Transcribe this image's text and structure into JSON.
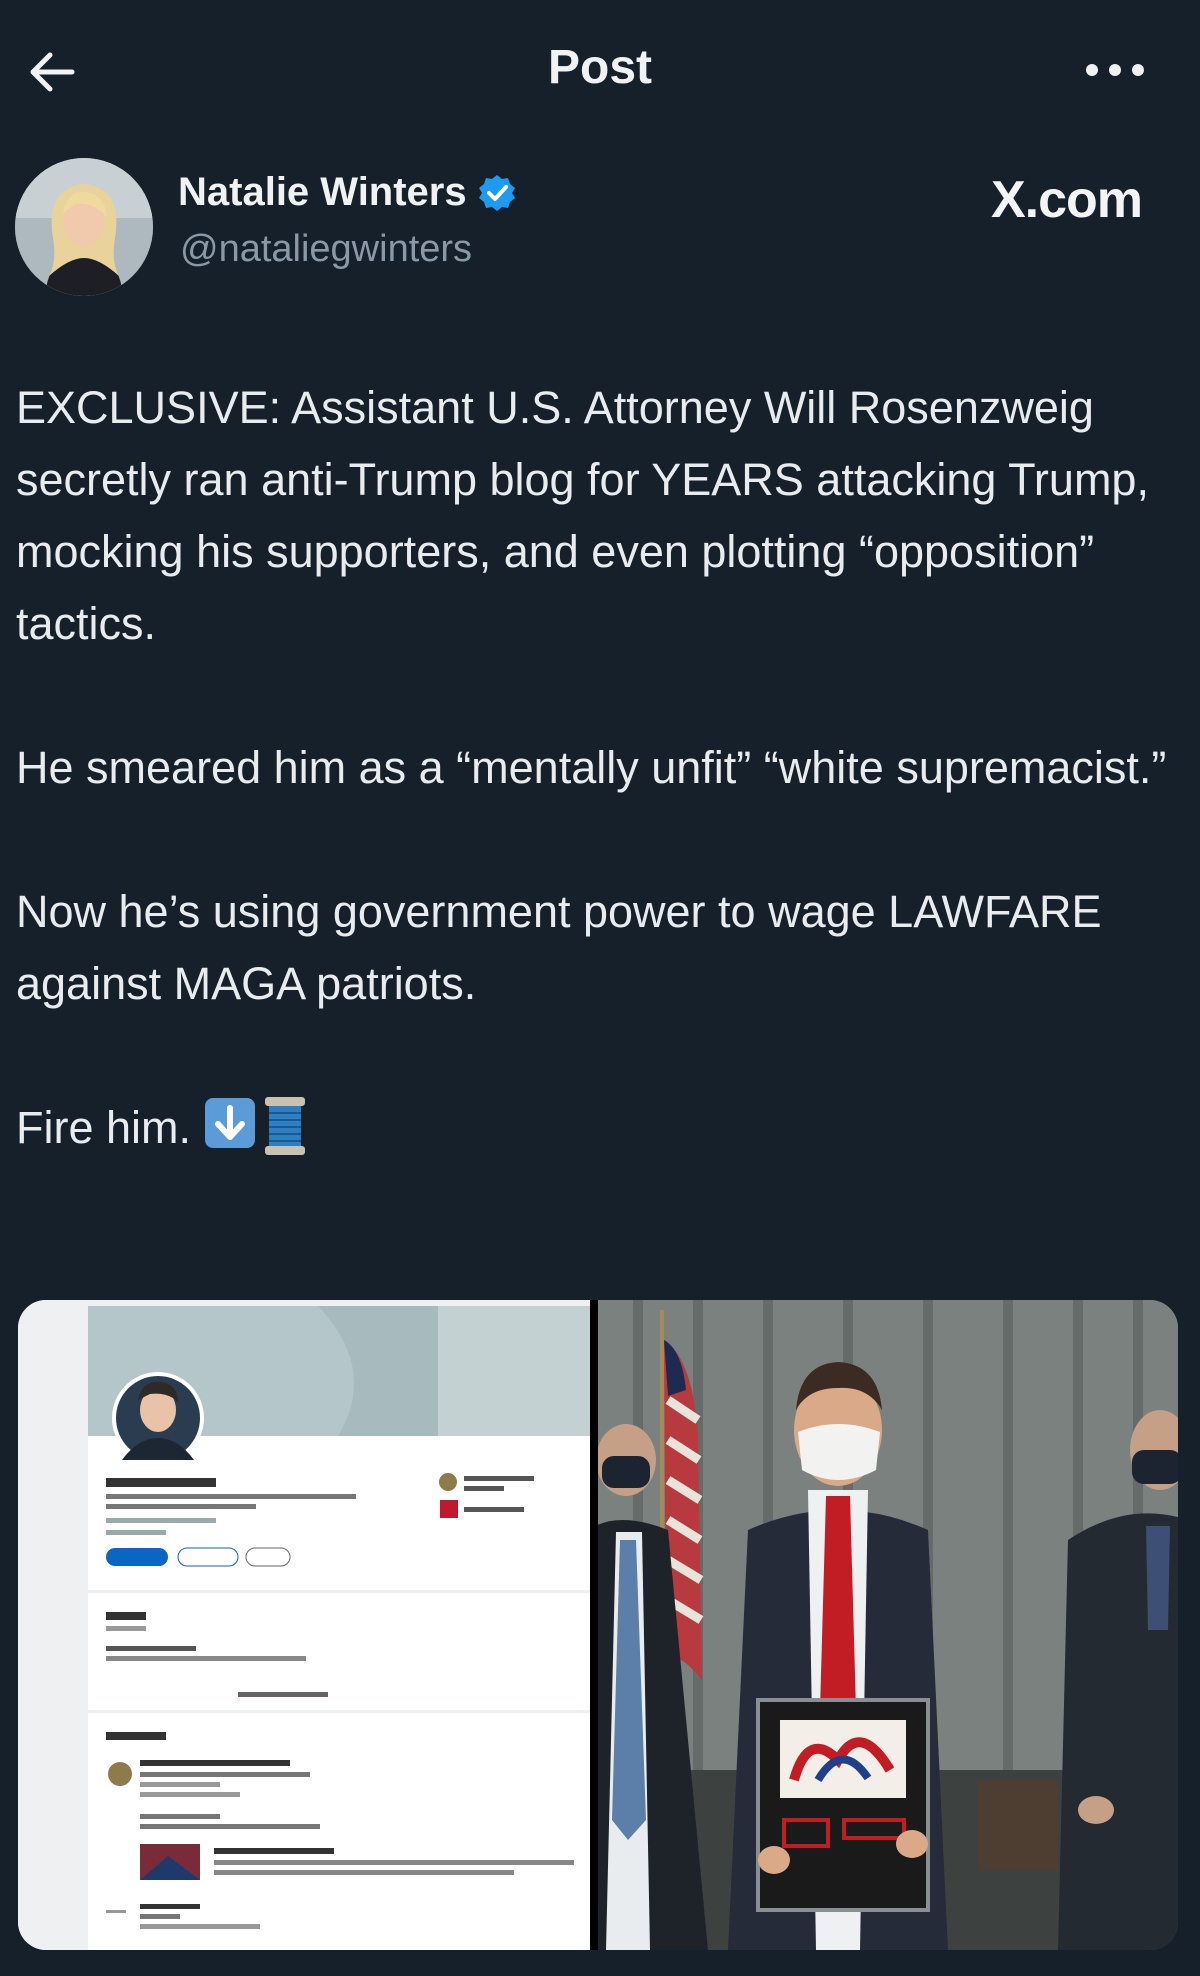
{
  "header": {
    "title": "Post",
    "back_icon": "arrow-left-icon",
    "more_icon": "more-horizontal-icon"
  },
  "author": {
    "name": "Natalie Winters",
    "handle": "@nataliegwinters",
    "verified": true,
    "verified_color": "#1d9bf0"
  },
  "watermark": "X.com",
  "post": {
    "paragraphs": [
      "EXCLUSIVE: Assistant U.S. Attorney Will Rosenzweig secretly ran anti-Trump blog for YEARS attacking Trump, mocking his supporters, and even plotting “opposition” tactics.",
      "He smeared him as a “mentally unfit” “white supremacist.”",
      "Now he’s using government power to wage LAWFARE against MAGA patriots.",
      "Fire him."
    ],
    "emojis": [
      "down-arrow-emoji",
      "thread-spool-emoji"
    ]
  },
  "media": [
    {
      "kind": "screenshot",
      "description_icon": "linkedin-profile-image"
    },
    {
      "kind": "photo",
      "description_icon": "award-photo-image"
    }
  ],
  "colors": {
    "background": "#15202b",
    "text": "#e7e9ea",
    "secondary_text": "#8b98a5"
  }
}
